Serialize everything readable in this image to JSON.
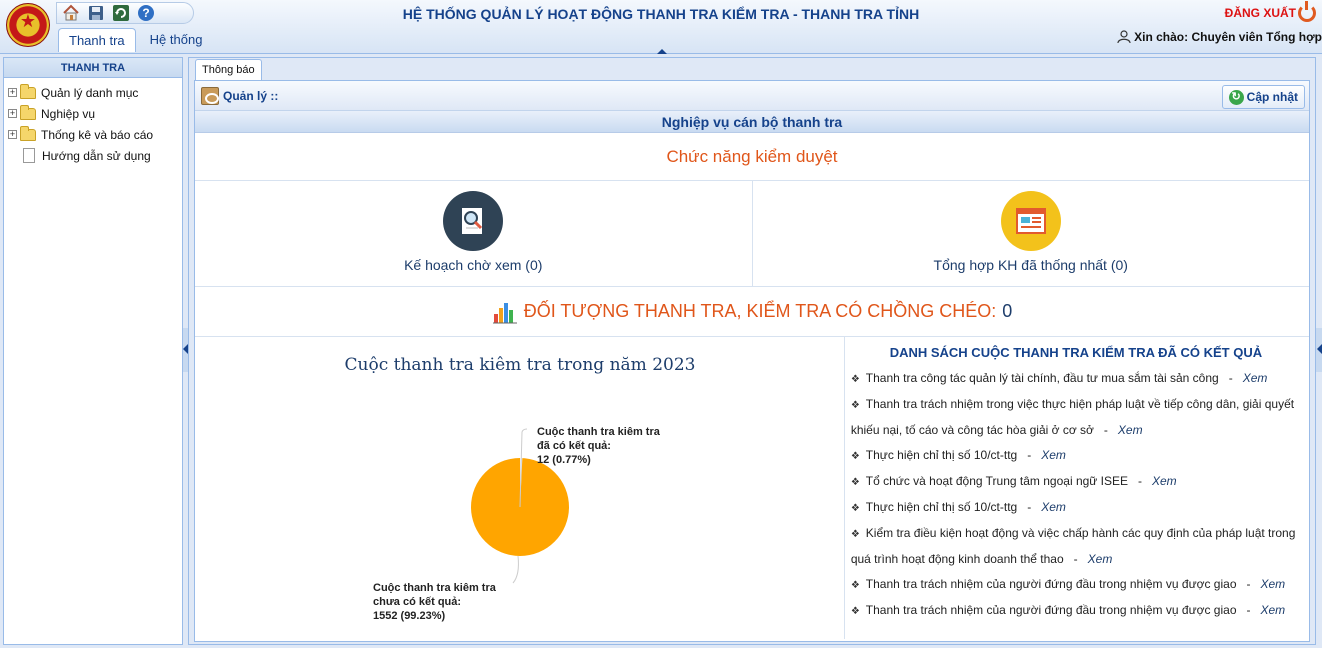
{
  "header": {
    "title": "HỆ THỐNG QUẢN LÝ HOẠT ĐỘNG THANH TRA KIỂM TRA - THANH TRA TỈNH",
    "logout": "ĐĂNG XUẤT",
    "greeting": "Xin chào: Chuyên viên Tổng hợp",
    "tabs": [
      "Thanh tra",
      "Hệ thống"
    ],
    "quick_icons": [
      "home-icon",
      "save-icon",
      "refresh-icon",
      "help-icon"
    ]
  },
  "sidebar": {
    "title": "THANH TRA",
    "items": [
      {
        "label": "Quản lý danh mục",
        "type": "folder"
      },
      {
        "label": "Nghiệp vụ",
        "type": "folder"
      },
      {
        "label": "Thống kê và báo cáo",
        "type": "folder"
      },
      {
        "label": "Hướng dẫn sử dụng",
        "type": "doc"
      }
    ]
  },
  "main": {
    "tab": "Thông báo",
    "toolbar_title": "Quản lý ::",
    "refresh": "Cập nhật",
    "section_title": "Nghiệp vụ cán bộ thanh tra",
    "function_title": "Chức năng kiểm duyệt",
    "functions": [
      {
        "label": "Kế hoạch chờ xem (0)",
        "icon": "search-document-icon"
      },
      {
        "label": "Tổng hợp KH đã thống nhất (0)",
        "icon": "report-icon"
      }
    ],
    "overlap_label": "ĐỐI TƯỢNG THANH TRA, KIỂM TRA CÓ CHỒNG CHÉO:",
    "overlap_count": "0",
    "chart_title": "Cuộc thanh tra kiêm tra trong năm 2023",
    "list_title": "DANH SÁCH CUỘC THANH TRA KIỂM TRA ĐÃ CÓ KẾT QUẢ",
    "view_label": "Xem",
    "list": [
      "Thanh tra công tác quản lý tài chính, đầu tư mua sắm tài sản công",
      "Thanh tra trách nhiệm trong việc thực hiện pháp luật về tiếp công dân, giải quyết khiếu nại, tố cáo và công tác hòa giải ở cơ sở",
      "Thực hiện chỉ thị số 10/ct-ttg",
      "Tổ chức và hoạt động Trung tâm ngoại ngữ ISEE",
      "Thực hiện chỉ thị số 10/ct-ttg",
      "Kiểm tra điều kiện hoạt động và việc chấp hành các quy định của pháp luật trong quá trình hoạt động kinh doanh thể thao",
      "Thanh tra trách nhiệm của người đứng đầu trong nhiệm vụ được giao",
      "Thanh tra trách nhiệm của người đứng đầu trong nhiệm vụ được giao"
    ],
    "slice_labels": [
      {
        "line1": "Cuộc thanh tra kiêm tra",
        "line2": "đã có kết quả:",
        "line3": "12 (0.77%)"
      },
      {
        "line1": "Cuộc thanh tra kiêm tra",
        "line2": "chưa có kết quả:",
        "line3": "1552 (99.23%)"
      }
    ]
  },
  "chart_data": {
    "type": "pie",
    "title": "Cuộc thanh tra kiêm tra trong năm 2023",
    "slices": [
      {
        "label": "Cuộc thanh tra kiêm tra đã có kết quả",
        "value": 12,
        "percent": 0.77,
        "color": "#f2f2f2"
      },
      {
        "label": "Cuộc thanh tra kiêm tra chưa có kết quả",
        "value": 1552,
        "percent": 99.23,
        "color": "#ffa500"
      }
    ]
  }
}
